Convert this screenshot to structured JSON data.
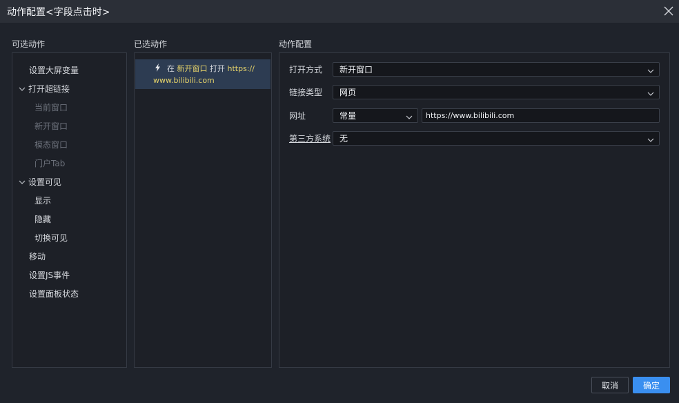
{
  "window": {
    "title": "动作配置<字段点击时>"
  },
  "sections": {
    "available": "可选动作",
    "selected": "已选动作",
    "config": "动作配置"
  },
  "available_actions": {
    "set_screen_var": "设置大屏变量",
    "open_link": {
      "label": "打开超链接",
      "children": [
        "当前窗口",
        "新开窗口",
        "模态窗口",
        "门户Tab"
      ]
    },
    "set_visible": {
      "label": "设置可见",
      "children": [
        "显示",
        "隐藏",
        "切换可见"
      ]
    },
    "move": "移动",
    "set_js_event": "设置JS事件",
    "set_panel_state": "设置面板状态"
  },
  "selected_action": {
    "prefix": "在",
    "target": "新开窗口",
    "verb": "打开",
    "url_part1": "https://",
    "url_part2": "www.bilibili.com"
  },
  "config": {
    "open_mode": {
      "label": "打开方式",
      "value": "新开窗口"
    },
    "link_type": {
      "label": "链接类型",
      "value": "网页"
    },
    "url": {
      "label": "网址",
      "mode": "常量",
      "value": "https://www.bilibili.com"
    },
    "third_party": {
      "label": "第三方系统",
      "value": "无"
    }
  },
  "buttons": {
    "cancel": "取消",
    "ok": "确定"
  },
  "colors": {
    "accent": "#3a8ff0",
    "highlight": "#e6d36a",
    "selected_bg": "#2d3c52"
  }
}
